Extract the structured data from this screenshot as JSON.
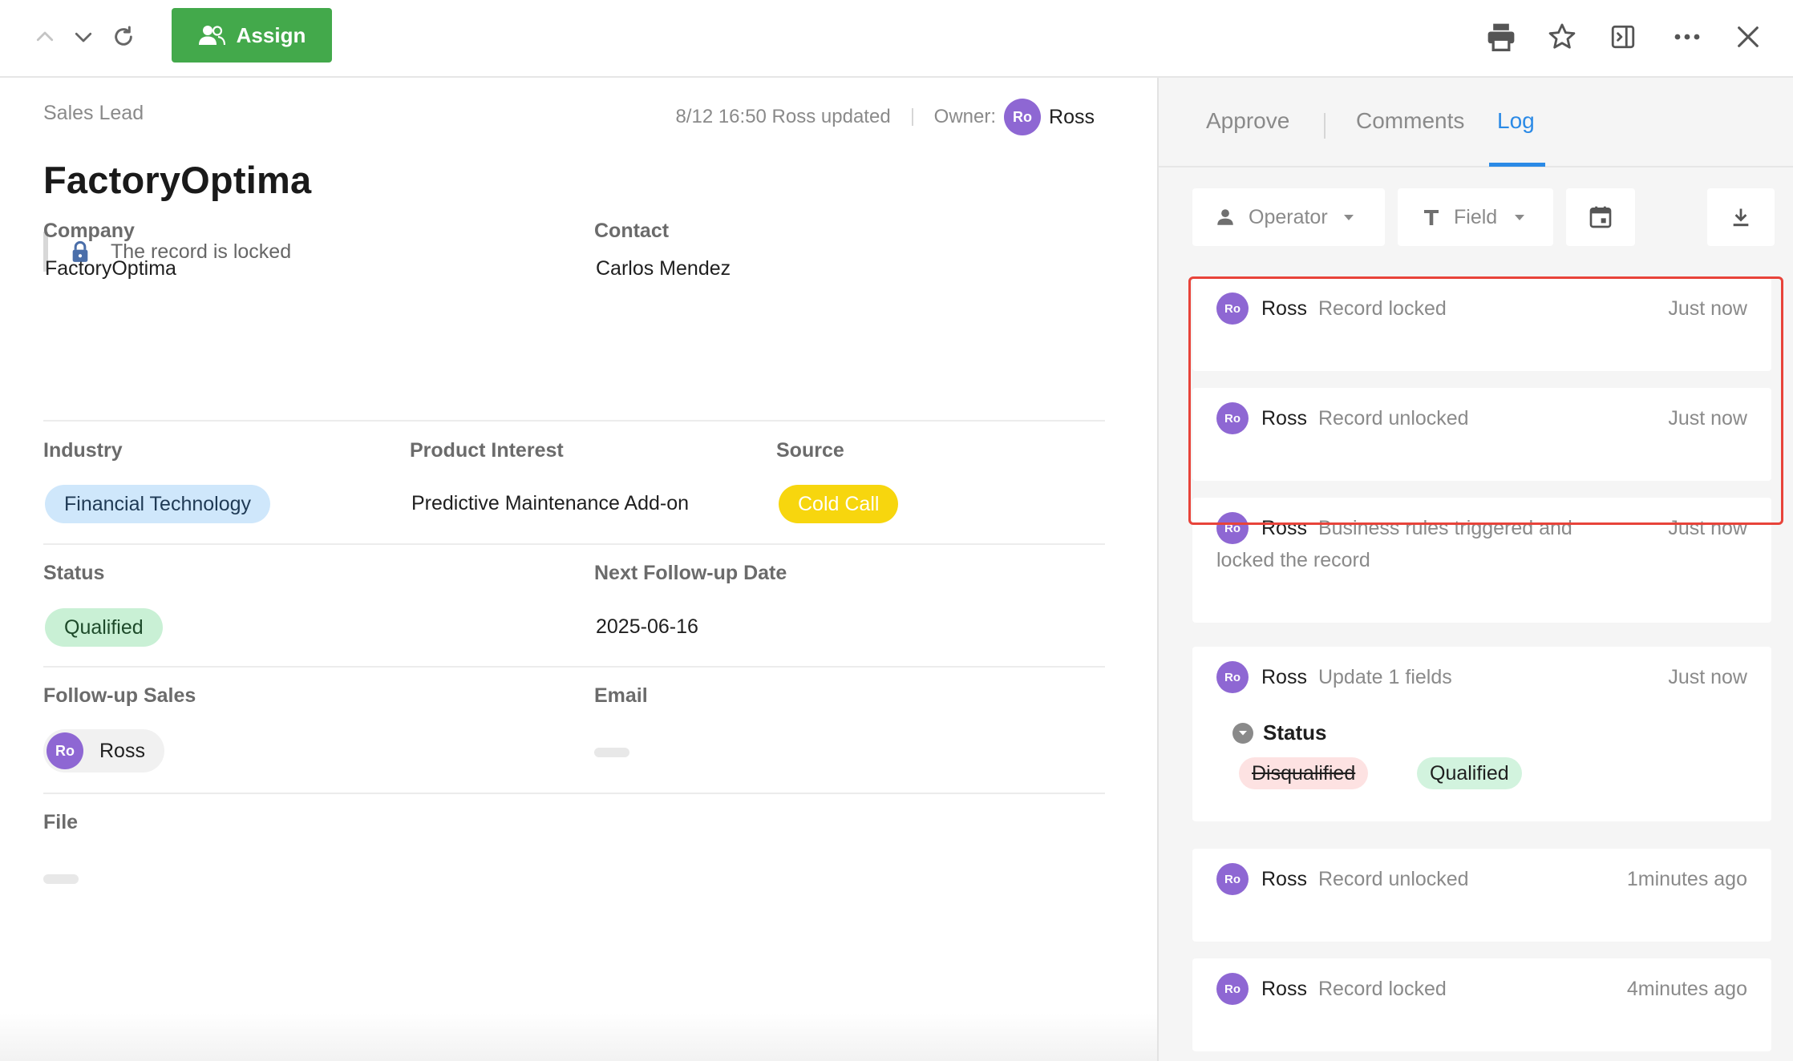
{
  "toolbar": {
    "assign_label": "Assign",
    "icons": [
      "chevron-up-icon",
      "chevron-down-icon",
      "refresh-icon",
      "print-icon",
      "star-icon",
      "side-panel-icon",
      "more-icon",
      "close-icon"
    ]
  },
  "record": {
    "breadcrumb": "Sales Lead",
    "updated_meta": "8/12 16:50 Ross updated",
    "owner_label": "Owner:",
    "owner_initials": "Ro",
    "owner_name": "Ross",
    "title": "FactoryOptima",
    "locked_note": "The record is locked"
  },
  "fields": {
    "company": {
      "label": "Company",
      "value": "FactoryOptima"
    },
    "contact": {
      "label": "Contact",
      "value": "Carlos Mendez"
    },
    "industry": {
      "label": "Industry",
      "value": "Financial Technology"
    },
    "product_interest": {
      "label": "Product Interest",
      "value": "Predictive Maintenance Add-on"
    },
    "source": {
      "label": "Source",
      "value": "Cold Call"
    },
    "status": {
      "label": "Status",
      "value": "Qualified"
    },
    "next_followup": {
      "label": "Next Follow-up Date",
      "value": "2025-06-16"
    },
    "followup_sales": {
      "label": "Follow-up Sales",
      "initials": "Ro",
      "value": "Ross"
    },
    "email": {
      "label": "Email"
    },
    "file": {
      "label": "File"
    }
  },
  "panel": {
    "tabs": [
      {
        "label": "Approve",
        "active": false
      },
      {
        "label": "Comments",
        "active": false
      },
      {
        "label": "Log",
        "active": true
      }
    ],
    "filters": {
      "operator_label": "Operator",
      "field_label": "Field"
    },
    "logs": [
      {
        "initials": "Ro",
        "user": "Ross",
        "action": "Record locked",
        "time": "Just now"
      },
      {
        "initials": "Ro",
        "user": "Ross",
        "action": "Record unlocked",
        "time": "Just now"
      },
      {
        "initials": "Ro",
        "user": "Ross",
        "action": "Business rules triggered and",
        "action_cont": "locked the record",
        "time": "Just now"
      },
      {
        "initials": "Ro",
        "user": "Ross",
        "action": "Update 1 fields",
        "time": "Just now",
        "change_field": "Status",
        "old_value": "Disqualified",
        "new_value": "Qualified"
      },
      {
        "initials": "Ro",
        "user": "Ross",
        "action": "Record unlocked",
        "time": "1minutes ago"
      },
      {
        "initials": "Ro",
        "user": "Ross",
        "action": "Record locked",
        "time": "4minutes ago"
      }
    ]
  },
  "colors": {
    "accent": "#2b8ae6",
    "assign_green": "#43a94b",
    "avatar_purple": "#8e67d3",
    "highlight_red": "#e8433a",
    "source_yellow": "#f7d60e"
  }
}
